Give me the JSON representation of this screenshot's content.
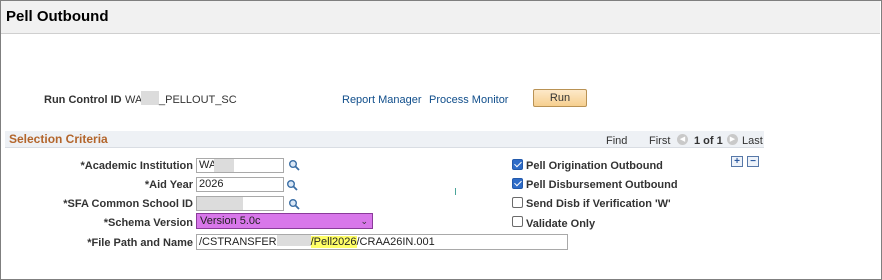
{
  "page": {
    "title": "Pell Outbound"
  },
  "run_control": {
    "label": "Run Control ID",
    "value_prefix": "WA",
    "value_suffix": "_PELLOUT_SC",
    "report_manager": "Report Manager",
    "process_monitor": "Process Monitor",
    "run_button": "Run"
  },
  "section": {
    "title": "Selection Criteria",
    "find": "Find",
    "first": "First",
    "pager": "1 of 1",
    "last": "Last",
    "add_row": "+",
    "delete_row": "−"
  },
  "fields": {
    "academic_institution": {
      "label": "*Academic Institution",
      "value": "WA"
    },
    "aid_year": {
      "label": "*Aid Year",
      "value": "2026"
    },
    "school_id": {
      "label": "*SFA Common School ID",
      "value": ""
    },
    "schema_version": {
      "label": "*Schema Version",
      "value": "Version 5.0c"
    },
    "file_path": {
      "label": "*File Path and Name",
      "part1": "/CSTRANSFER",
      "part2": "/Pell2026",
      "part3": "/CRAA26IN.001"
    }
  },
  "checkboxes": [
    {
      "label": "Pell Origination Outbound",
      "checked": true
    },
    {
      "label": "Pell Disbursement Outbound",
      "checked": true
    },
    {
      "label": "Send Disb if Verification 'W'",
      "checked": false
    },
    {
      "label": "Validate Only",
      "checked": false
    }
  ],
  "icons": {
    "lookup": "search-icon",
    "nav_prev": "chevron-left-icon",
    "nav_next": "chevron-right-icon",
    "select_caret": "chevron-down-icon"
  },
  "colors": {
    "section_title": "#b3652b",
    "link": "#104e8b",
    "checkbox_on": "#2e6cc8",
    "schema_select": "#d877ea",
    "path_highlight": "#ffff66"
  }
}
